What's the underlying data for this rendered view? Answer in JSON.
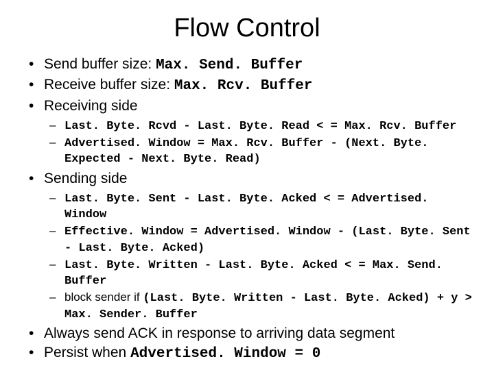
{
  "title": "Flow Control",
  "b1": {
    "label": "Send buffer size: ",
    "code": "Max. Send. Buffer"
  },
  "b2": {
    "label": "Receive buffer size: ",
    "code": "Max. Rcv. Buffer"
  },
  "b3": {
    "label": "Receiving side"
  },
  "b3s": {
    "a": "Last. Byte. Rcvd - Last. Byte. Read < = Max. Rcv. Buffer",
    "b": "Advertised. Window = Max. Rcv. Buffer - (Next. Byte. Expected - Next. Byte. Read)"
  },
  "b4": {
    "label": "Sending side"
  },
  "b4s": {
    "a": "Last. Byte. Sent - Last. Byte. Acked < = Advertised. Window",
    "b": "Effective. Window = Advertised. Window - (Last. Byte. Sent - Last. Byte. Acked)",
    "c": "Last. Byte. Written - Last. Byte. Acked < = Max. Send. Buffer",
    "d1": "block sender if ",
    "d2": "(Last. Byte. Written - Last. Byte. Acked) + y > Max. Sender. Buffer"
  },
  "b5": {
    "label": "Always send ACK in response to arriving data segment"
  },
  "b6": {
    "label": "Persist when ",
    "code": "Advertised. Window = 0"
  }
}
